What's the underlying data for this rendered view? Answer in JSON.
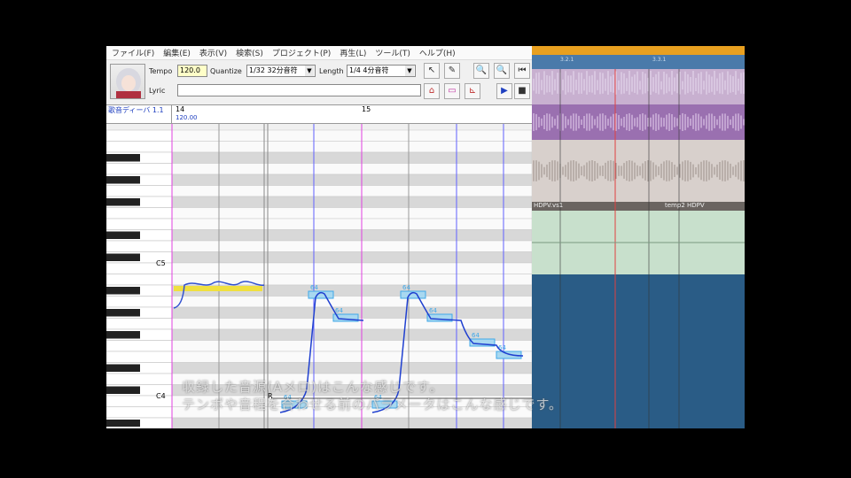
{
  "menu": [
    "ファイル(F)",
    "編集(E)",
    "表示(V)",
    "検索(S)",
    "プロジェクト(P)",
    "再生(L)",
    "ツール(T)",
    "ヘルプ(H)"
  ],
  "toolbar": {
    "tempo_label": "Tempo",
    "tempo_value": "120.0",
    "quantize_label": "Quantize",
    "quantize_value": "1/32 32分音符",
    "length_label": "Length",
    "length_value": "1/4 4分音符",
    "lyric_label": "Lyric",
    "lyric_value": ""
  },
  "ruler": {
    "track_name": "歌音ディーバ 1.1",
    "measure_a": "14",
    "measure_b": "15",
    "tempo_marker": "120.00"
  },
  "piano": {
    "c5": "C5",
    "c4": "C4"
  },
  "notes": {
    "rest_label": "R",
    "vel": "64"
  },
  "daw": {
    "track_label_a": "HDPV.vs1",
    "track_label_b": "temp2 HDPV",
    "marker_a": "3.2.1",
    "marker_b": "3.3.1"
  },
  "subtitle": {
    "line1": "収録した音源(Aメロ)はこんな感じです。",
    "line2": "テンポや音程を合わせる前のパラメータはこんな感じです。"
  },
  "colors": {
    "accent_orange": "#e8a020",
    "note_blue": "#2a4ad0",
    "pitch_cyan": "#40a8e8"
  }
}
